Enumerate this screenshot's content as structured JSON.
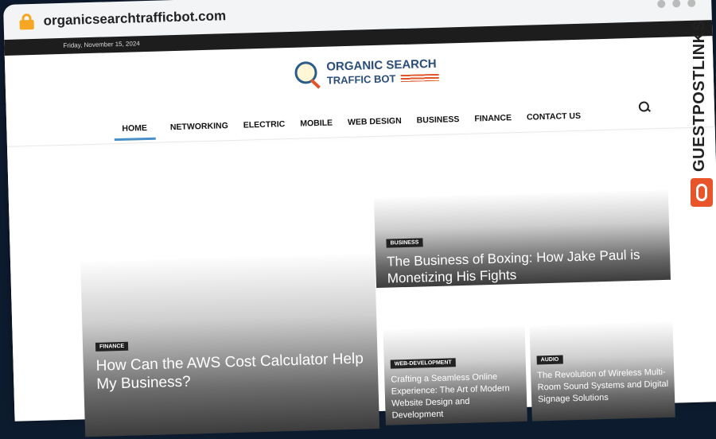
{
  "browser": {
    "url": "organicsearchtrafficbot.com"
  },
  "topbar": {
    "date": "Friday, November 15, 2024"
  },
  "logo": {
    "line1": "ORGANIC SEARCH",
    "line2": "TRAFFIC BOT"
  },
  "nav": {
    "items": [
      "HOME",
      "NETWORKING",
      "ELECTRIC",
      "MOBILE",
      "WEB DESIGN",
      "BUSINESS",
      "FINANCE",
      "CONTACT US"
    ],
    "active": "HOME"
  },
  "articles": [
    {
      "tag": "FINANCE",
      "title": "How Can the AWS Cost Calculator Help My Business?"
    },
    {
      "tag": "BUSINESS",
      "title": "The Business of Boxing: How Jake Paul is Monetizing His Fights"
    },
    {
      "tag": "WEB-DEVELOPMENT",
      "title": "Crafting a Seamless Online Experience: The Art of Modern Website Design and Development"
    },
    {
      "tag": "AUDIO",
      "title": "The Revolution of Wireless Multi-Room Sound Systems and Digital Signage Solutions"
    }
  ],
  "watermark": {
    "text": "GUESTPOSTLINKS"
  },
  "colors": {
    "accent": "#4a90c8",
    "brand_orange": "#e8552a",
    "topbar": "#1d1d1d"
  }
}
